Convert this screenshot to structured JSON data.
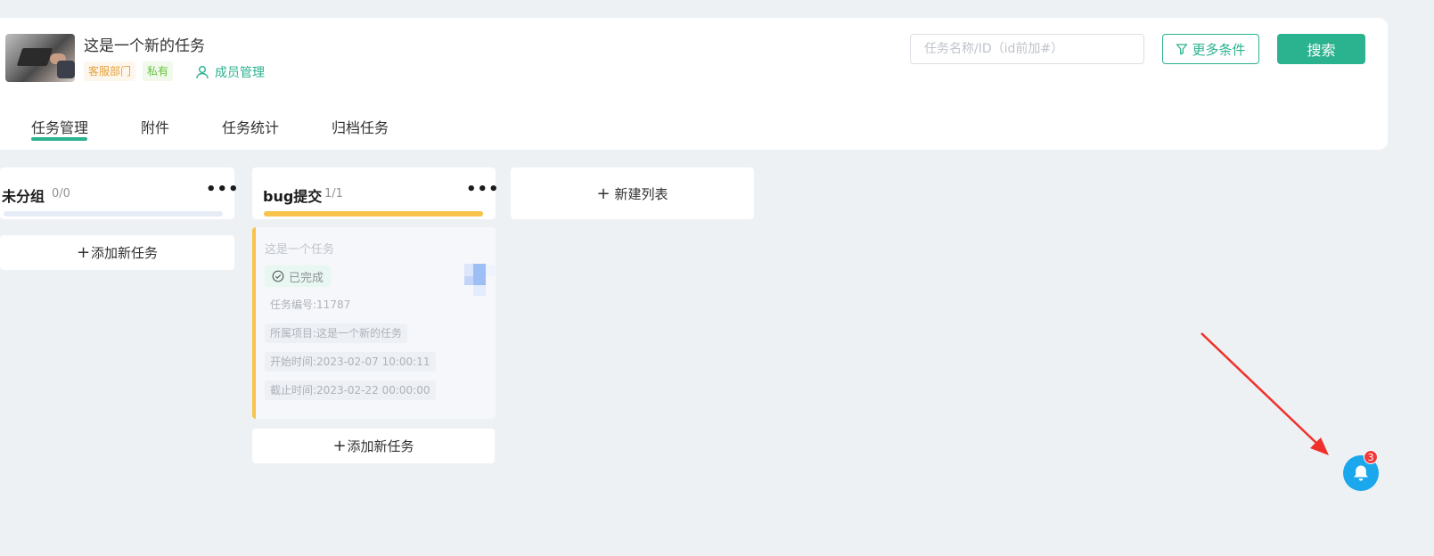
{
  "project": {
    "title": "这是一个新的任务",
    "tags": [
      "客服部门",
      "私有"
    ],
    "members_label": "成员管理"
  },
  "search": {
    "placeholder": "任务名称/ID（id前加#）",
    "more_label": "更多条件",
    "button_label": "搜索"
  },
  "tabs": [
    {
      "label": "任务管理",
      "active": true
    },
    {
      "label": "附件",
      "active": false
    },
    {
      "label": "任务统计",
      "active": false
    },
    {
      "label": "归档任务",
      "active": false
    }
  ],
  "columns": [
    {
      "title": "未分组",
      "count": "0/0",
      "progress": 0.0,
      "progress_color": "#e6ecf5",
      "add_label": "添加新任务"
    },
    {
      "title": "bug提交",
      "count": "1/1",
      "progress": 1.0,
      "progress_color": "#f7c34a",
      "add_label": "添加新任务"
    }
  ],
  "task_card": {
    "title": "这是一个任务",
    "status": "已完成",
    "number": "任务编号:11787",
    "project": "所属项目:这是一个新的任务",
    "start": "开始时间:2023-02-07 10:00:11",
    "deadline": "截止时间:2023-02-22 00:00:00"
  },
  "new_list_label": "新建列表",
  "notifications": {
    "count": "3"
  },
  "colors": {
    "accent": "#2bb28f",
    "bell": "#1aa7ec",
    "badge": "#f23a3a",
    "arrow": "#f0302a"
  }
}
